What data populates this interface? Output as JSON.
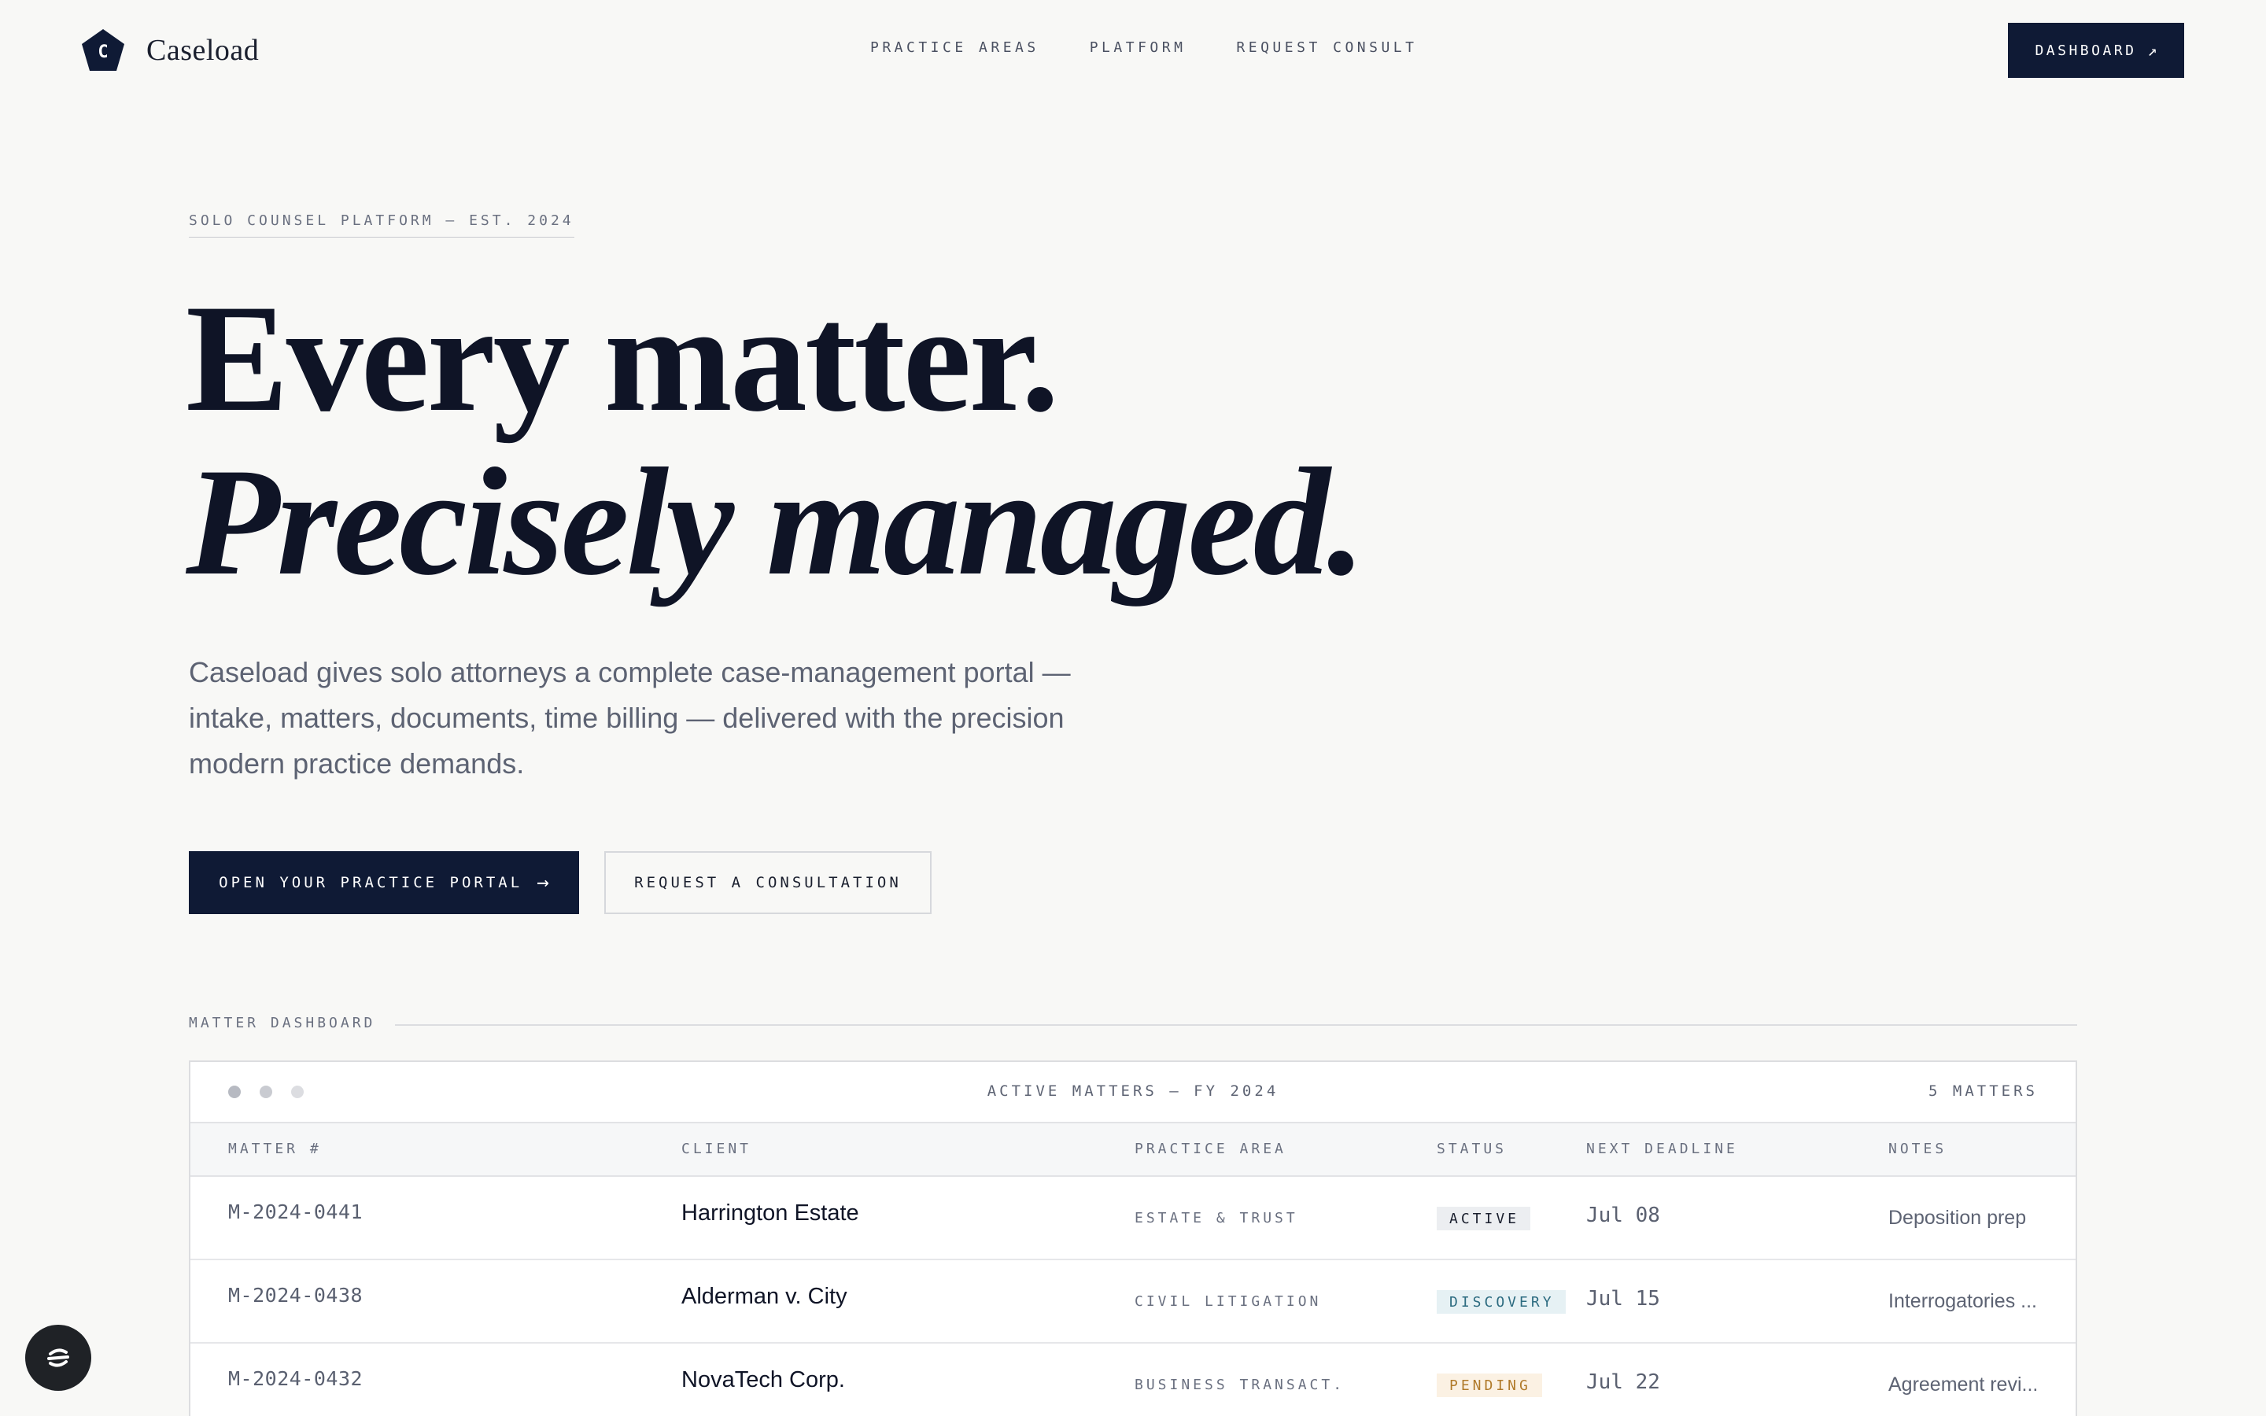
{
  "brand": {
    "mark_letter": "C",
    "name": "Caseload"
  },
  "nav": [
    {
      "label": "PRACTICE AREAS"
    },
    {
      "label": "PLATFORM"
    },
    {
      "label": "REQUEST CONSULT"
    }
  ],
  "header": {
    "dashboard_label": "DASHBOARD",
    "dashboard_icon": "↗"
  },
  "hero": {
    "eyebrow": "SOLO COUNSEL PLATFORM — EST. 2024",
    "headline_line1": "Every matter.",
    "headline_line2": "Precisely managed.",
    "lede": "Caseload gives solo attorneys a complete case-management portal — intake, matters, documents, time billing — delivered with the precision modern practice demands.",
    "primary_cta": "OPEN YOUR PRACTICE PORTAL",
    "primary_cta_icon": "→",
    "secondary_cta": "REQUEST A CONSULTATION"
  },
  "dashboard": {
    "section_label": "MATTER DASHBOARD",
    "panel_title": "ACTIVE MATTERS — FY 2024",
    "matter_count": "5 MATTERS",
    "columns": [
      "MATTER #",
      "CLIENT",
      "PRACTICE AREA",
      "STATUS",
      "NEXT DEADLINE",
      "NOTES"
    ],
    "rows": [
      {
        "matter": "M-2024-0441",
        "client": "Harrington Estate",
        "area": "ESTATE & TRUST",
        "status": "ACTIVE",
        "deadline": "Jul 08",
        "notes": "Deposition prep"
      },
      {
        "matter": "M-2024-0438",
        "client": "Alderman v. City",
        "area": "CIVIL LITIGATION",
        "status": "DISCOVERY",
        "deadline": "Jul 15",
        "notes": "Interrogatories ..."
      },
      {
        "matter": "M-2024-0432",
        "client": "NovaTech Corp.",
        "area": "BUSINESS TRANSACT.",
        "status": "PENDING",
        "deadline": "Jul 22",
        "notes": "Agreement revi..."
      }
    ]
  },
  "status_colors": {
    "ACTIVE": {
      "bg": "#eceef1",
      "fg": "#1a1f2e"
    },
    "DISCOVERY": {
      "bg": "#e6f1f4",
      "fg": "#2c6b80"
    },
    "PENDING": {
      "bg": "#fbf1e3",
      "fg": "#b07a2a"
    }
  },
  "colors": {
    "accent": "#0f1a35",
    "background": "#f8f8f6"
  },
  "icons": {
    "fab": "chat-widget-icon"
  }
}
